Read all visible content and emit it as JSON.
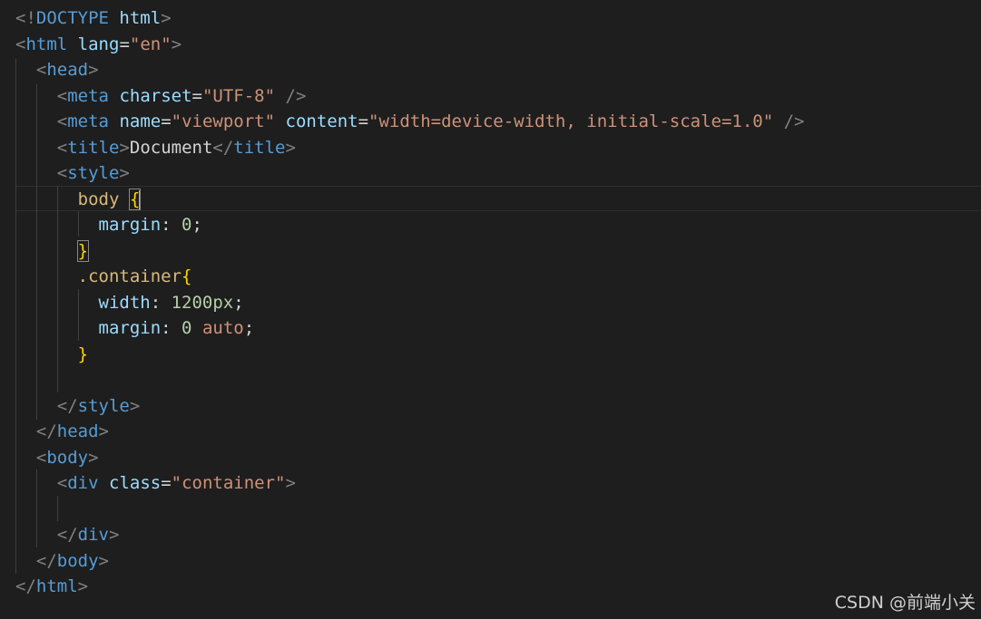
{
  "editor": {
    "lines": [
      [
        [
          "punct",
          "<!"
        ],
        [
          "tag",
          "DOCTYPE"
        ],
        [
          "text",
          " "
        ],
        [
          "attr",
          "html"
        ],
        [
          "punct",
          ">"
        ]
      ],
      [
        [
          "punct",
          "<"
        ],
        [
          "tag",
          "html"
        ],
        [
          "text",
          " "
        ],
        [
          "attr",
          "lang"
        ],
        [
          "eq",
          "="
        ],
        [
          "str",
          "\"en\""
        ],
        [
          "punct",
          ">"
        ]
      ],
      [
        [
          "text",
          "  "
        ],
        [
          "punct",
          "<"
        ],
        [
          "tag",
          "head"
        ],
        [
          "punct",
          ">"
        ]
      ],
      [
        [
          "text",
          "    "
        ],
        [
          "punct",
          "<"
        ],
        [
          "tag",
          "meta"
        ],
        [
          "text",
          " "
        ],
        [
          "attr",
          "charset"
        ],
        [
          "eq",
          "="
        ],
        [
          "str",
          "\"UTF-8\""
        ],
        [
          "text",
          " "
        ],
        [
          "punct",
          "/>"
        ]
      ],
      [
        [
          "text",
          "    "
        ],
        [
          "punct",
          "<"
        ],
        [
          "tag",
          "meta"
        ],
        [
          "text",
          " "
        ],
        [
          "attr",
          "name"
        ],
        [
          "eq",
          "="
        ],
        [
          "str",
          "\"viewport\""
        ],
        [
          "text",
          " "
        ],
        [
          "attr",
          "content"
        ],
        [
          "eq",
          "="
        ],
        [
          "str",
          "\"width=device-width, initial-scale=1.0\""
        ],
        [
          "text",
          " "
        ],
        [
          "punct",
          "/>"
        ]
      ],
      [
        [
          "text",
          "    "
        ],
        [
          "punct",
          "<"
        ],
        [
          "tag",
          "title"
        ],
        [
          "punct",
          ">"
        ],
        [
          "text",
          "Document"
        ],
        [
          "punct",
          "</"
        ],
        [
          "tag",
          "title"
        ],
        [
          "punct",
          ">"
        ]
      ],
      [
        [
          "text",
          "    "
        ],
        [
          "punct",
          "<"
        ],
        [
          "tag",
          "style"
        ],
        [
          "punct",
          ">"
        ]
      ],
      [
        [
          "text",
          "      "
        ],
        [
          "selector",
          "body"
        ],
        [
          "text",
          " "
        ],
        [
          "brace-match",
          "{"
        ],
        [
          "cursor",
          ""
        ]
      ],
      [
        [
          "text",
          "        "
        ],
        [
          "prop",
          "margin"
        ],
        [
          "text",
          ": "
        ],
        [
          "num",
          "0"
        ],
        [
          "text",
          ";"
        ]
      ],
      [
        [
          "text",
          "      "
        ],
        [
          "brace-match",
          "}"
        ]
      ],
      [
        [
          "text",
          "      "
        ],
        [
          "selector",
          ".container"
        ],
        [
          "brace",
          "{"
        ]
      ],
      [
        [
          "text",
          "        "
        ],
        [
          "prop",
          "width"
        ],
        [
          "text",
          ": "
        ],
        [
          "num",
          "1200px"
        ],
        [
          "text",
          ";"
        ]
      ],
      [
        [
          "text",
          "        "
        ],
        [
          "prop",
          "margin"
        ],
        [
          "text",
          ": "
        ],
        [
          "num",
          "0"
        ],
        [
          "text",
          " "
        ],
        [
          "kwval",
          "auto"
        ],
        [
          "text",
          ";"
        ]
      ],
      [
        [
          "text",
          "      "
        ],
        [
          "brace",
          "}"
        ]
      ],
      [
        [
          "text",
          ""
        ]
      ],
      [
        [
          "text",
          "    "
        ],
        [
          "punct",
          "</"
        ],
        [
          "tag",
          "style"
        ],
        [
          "punct",
          ">"
        ]
      ],
      [
        [
          "text",
          "  "
        ],
        [
          "punct",
          "</"
        ],
        [
          "tag",
          "head"
        ],
        [
          "punct",
          ">"
        ]
      ],
      [
        [
          "text",
          "  "
        ],
        [
          "punct",
          "<"
        ],
        [
          "tag",
          "body"
        ],
        [
          "punct",
          ">"
        ]
      ],
      [
        [
          "text",
          "    "
        ],
        [
          "punct",
          "<"
        ],
        [
          "tag",
          "div"
        ],
        [
          "text",
          " "
        ],
        [
          "attr",
          "class"
        ],
        [
          "eq",
          "="
        ],
        [
          "str",
          "\"container\""
        ],
        [
          "punct",
          ">"
        ]
      ],
      [
        [
          "text",
          ""
        ]
      ],
      [
        [
          "text",
          "    "
        ],
        [
          "punct",
          "</"
        ],
        [
          "tag",
          "div"
        ],
        [
          "punct",
          ">"
        ]
      ],
      [
        [
          "text",
          "  "
        ],
        [
          "punct",
          "</"
        ],
        [
          "tag",
          "body"
        ],
        [
          "punct",
          ">"
        ]
      ],
      [
        [
          "punct",
          "</"
        ],
        [
          "tag",
          "html"
        ],
        [
          "punct",
          ">"
        ]
      ]
    ]
  },
  "watermark": "CSDN @前端小关",
  "colors": {
    "background": "#1e1e1e",
    "tag": "#569cd6",
    "attribute": "#9cdcfe",
    "string": "#ce9178",
    "selector": "#d7ba7d",
    "brace": "#ffd700",
    "number": "#b5cea8",
    "punctuation": "#808080"
  }
}
